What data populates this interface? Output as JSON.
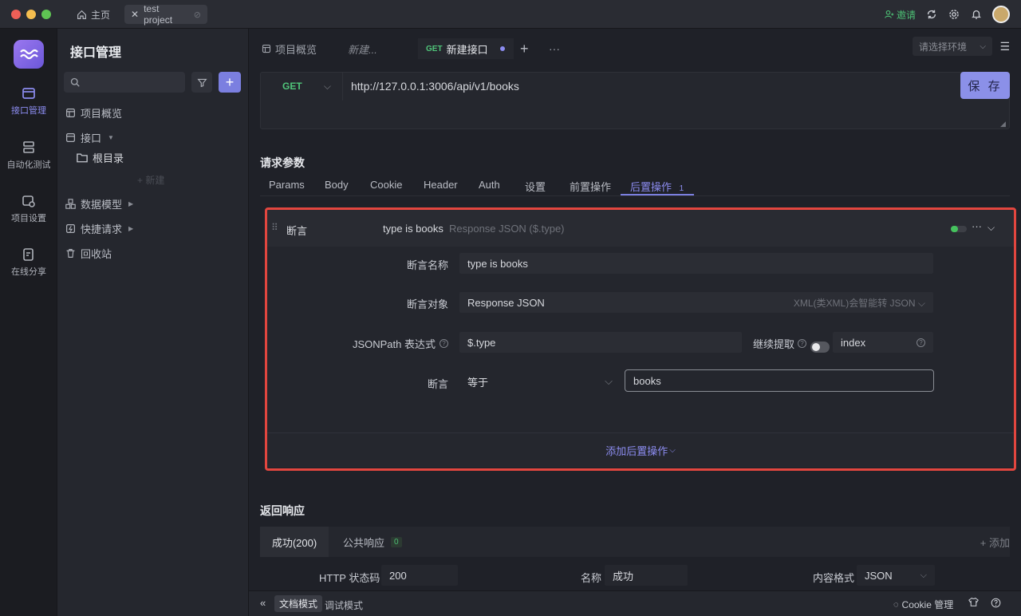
{
  "titlebar": {
    "home_label": "主页",
    "project_tab_label": "test project",
    "invite_label": "邀请"
  },
  "rail": {
    "items": [
      {
        "label": "接口管理",
        "icon": "api-icon"
      },
      {
        "label": "自动化测试",
        "icon": "automation-icon"
      },
      {
        "label": "项目设置",
        "icon": "project-settings-icon"
      },
      {
        "label": "在线分享",
        "icon": "share-icon"
      }
    ]
  },
  "sidebar": {
    "title": "接口管理",
    "items": {
      "overview": "项目概览",
      "api": "接口",
      "root_dir": "根目录",
      "new": "+ 新建",
      "data_model": "数据模型",
      "quick_request": "快捷请求",
      "trash": "回收站"
    }
  },
  "main_tabs": {
    "overview": "项目概览",
    "new_draft": "新建...",
    "active_method": "GET",
    "active_label": "新建接口",
    "env_placeholder": "请选择环境"
  },
  "request": {
    "method": "GET",
    "url": "http://127.0.0.1:3006/api/v1/books",
    "save_label": "保 存"
  },
  "params": {
    "title": "请求参数",
    "tabs": [
      "Params",
      "Body",
      "Cookie",
      "Header",
      "Auth",
      "设置",
      "前置操作",
      "后置操作"
    ],
    "active_tab": "后置操作",
    "active_badge": "1"
  },
  "assertion": {
    "type_label": "断言",
    "summary_name": "type is books",
    "summary_detail": "Response JSON ($.type)",
    "name_label": "断言名称",
    "name_value": "type is books",
    "target_label": "断言对象",
    "target_value": "Response JSON",
    "target_hint": "XML(类XML)会智能转 JSON",
    "jsonpath_label": "JSONPath 表达式",
    "jsonpath_value": "$.type",
    "continue_label": "继续提取",
    "index_label": "index",
    "assert_label": "断言",
    "operator_value": "等于",
    "expected_value": "books",
    "add_post_label": "添加后置操作"
  },
  "response": {
    "title": "返回响应",
    "tab_success": "成功(200)",
    "tab_public": "公共响应",
    "tab_public_badge": "0",
    "add_label": "+ 添加",
    "http_status_label": "HTTP 状态码",
    "http_status_value": "200",
    "name_label": "名称",
    "name_value": "成功",
    "content_type_label": "内容格式",
    "content_type_value": "JSON"
  },
  "bottombar": {
    "doc_mode": "文档模式",
    "debug_mode": "调试模式",
    "cookie_manage": "Cookie 管理"
  },
  "colors": {
    "accent": "#7b7fe0",
    "get_method": "#50c57a",
    "highlight_border": "#e2463f"
  }
}
